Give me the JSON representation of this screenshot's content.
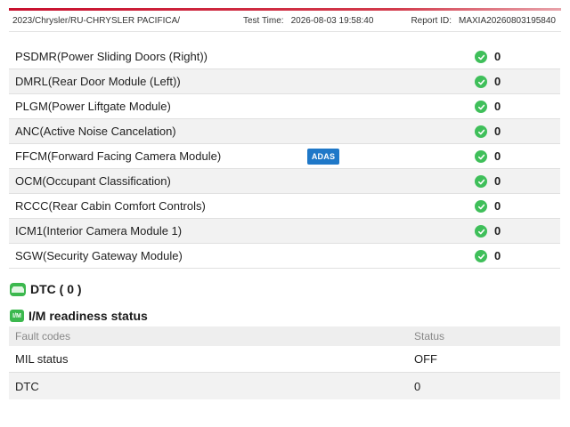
{
  "header": {
    "vehicle_path": "2023/Chrysler/RU-CHRYSLER PACIFICA/",
    "test_time_label": "Test Time:",
    "test_time_value": "2026-08-03 19:58:40",
    "report_id_label": "Report ID:",
    "report_id_value": "MAXIA20260803195840"
  },
  "modules": [
    {
      "name": "PSDMR(Power Sliding Doors (Right))",
      "count": "0"
    },
    {
      "name": "DMRL(Rear Door Module (Left))",
      "count": "0"
    },
    {
      "name": "PLGM(Power Liftgate Module)",
      "count": "0"
    },
    {
      "name": "ANC(Active Noise Cancelation)",
      "count": "0"
    },
    {
      "name": "FFCM(Forward Facing Camera Module)",
      "count": "0",
      "badge": "ADAS"
    },
    {
      "name": "OCM(Occupant Classification)",
      "count": "0"
    },
    {
      "name": "RCCC(Rear Cabin Comfort Controls)",
      "count": "0"
    },
    {
      "name": "ICM1(Interior Camera Module 1)",
      "count": "0"
    },
    {
      "name": "SGW(Security Gateway Module)",
      "count": "0"
    }
  ],
  "dtc_section": {
    "title": "DTC ( 0 )"
  },
  "im_section": {
    "icon_text": "I/M",
    "title": "I/M readiness status",
    "columns": [
      "Fault codes",
      "Status"
    ],
    "rows": [
      {
        "label": "MIL status",
        "value": "OFF"
      },
      {
        "label": "DTC",
        "value": "0"
      }
    ]
  },
  "colors": {
    "accent_red": "#c8102e",
    "ok_green": "#3fbf5a",
    "adas_blue": "#1f78c8"
  },
  "icons": {
    "module_status": "check-circle-icon",
    "dtc": "dtc-icon",
    "im": "im-icon"
  }
}
